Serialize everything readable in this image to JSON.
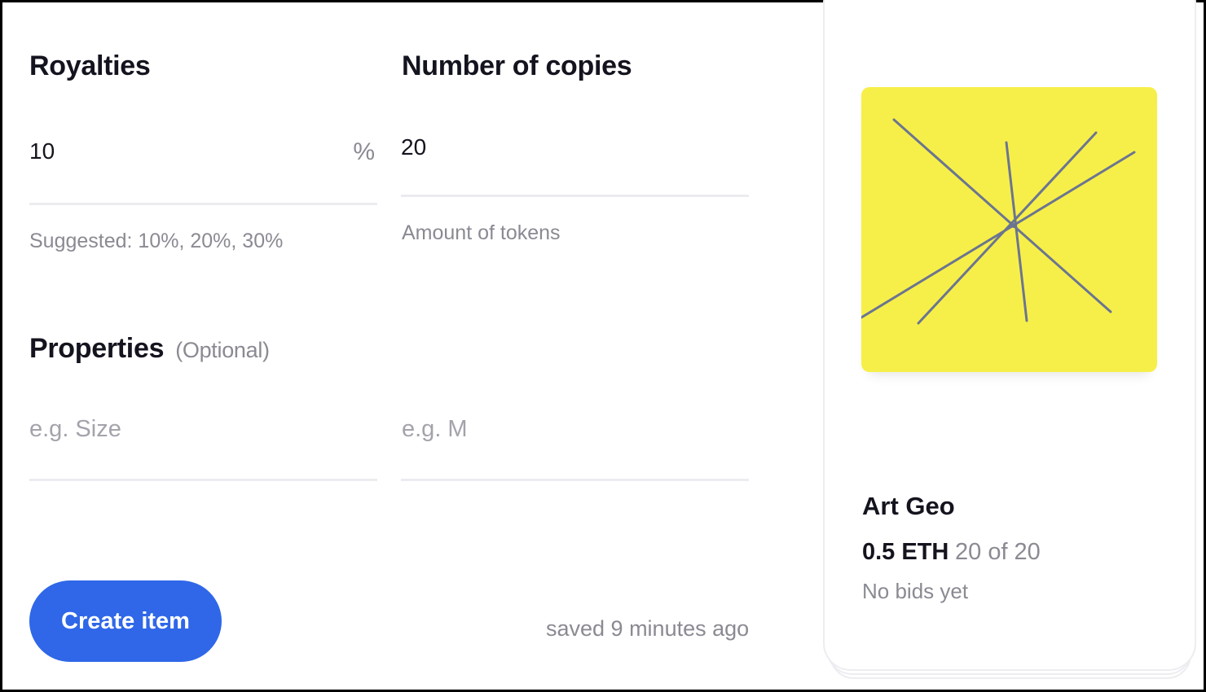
{
  "form": {
    "royalties": {
      "label": "Royalties",
      "value": "10",
      "unit": "%",
      "hint": "Suggested: 10%, 20%, 30%"
    },
    "copies": {
      "label": "Number of copies",
      "value": "20",
      "hint": "Amount of tokens"
    },
    "properties": {
      "label": "Properties",
      "optional": "(Optional)",
      "key_placeholder": "e.g. Size",
      "value_placeholder": "e.g. M"
    },
    "create_label": "Create item",
    "saved_status": "saved 9 minutes ago"
  },
  "preview": {
    "title": "Art Geo",
    "price": "0.5 ETH",
    "copies": "20 of 20",
    "bids": "No bids yet",
    "art_background": "#f7ef49",
    "art_stroke": "#6b7590"
  },
  "colors": {
    "accent": "#2f67e8",
    "text": "#14141f",
    "muted": "#8a8a93"
  }
}
